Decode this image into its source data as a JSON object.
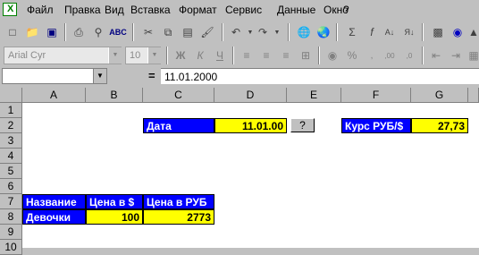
{
  "menu": [
    "Файл",
    "Правка",
    "Вид",
    "Вставка",
    "Формат",
    "Сервис",
    "Данные",
    "Окно",
    "?"
  ],
  "format_toolbar": {
    "font": "Arial Cyr",
    "size": "10"
  },
  "formula_bar": {
    "name_box": "",
    "equals": "=",
    "value": "11.01.2000"
  },
  "columns": [
    "A",
    "B",
    "C",
    "D",
    "E",
    "F",
    "G"
  ],
  "rows": [
    "1",
    "2",
    "3",
    "4",
    "5",
    "6",
    "7",
    "8",
    "9",
    "10"
  ],
  "cells": {
    "C2": "Дата",
    "D2": "11.01.00",
    "E2_button": "?",
    "F2": "Курс РУБ/$",
    "G2": "27,73",
    "A7": "Название",
    "B7": "Цена в $",
    "C7": "Цена в РУБ",
    "A8": "Девочки",
    "B8": "100",
    "C8": "2773"
  },
  "colors": {
    "header_bg": "#0000ff",
    "value_bg": "#ffff00"
  }
}
